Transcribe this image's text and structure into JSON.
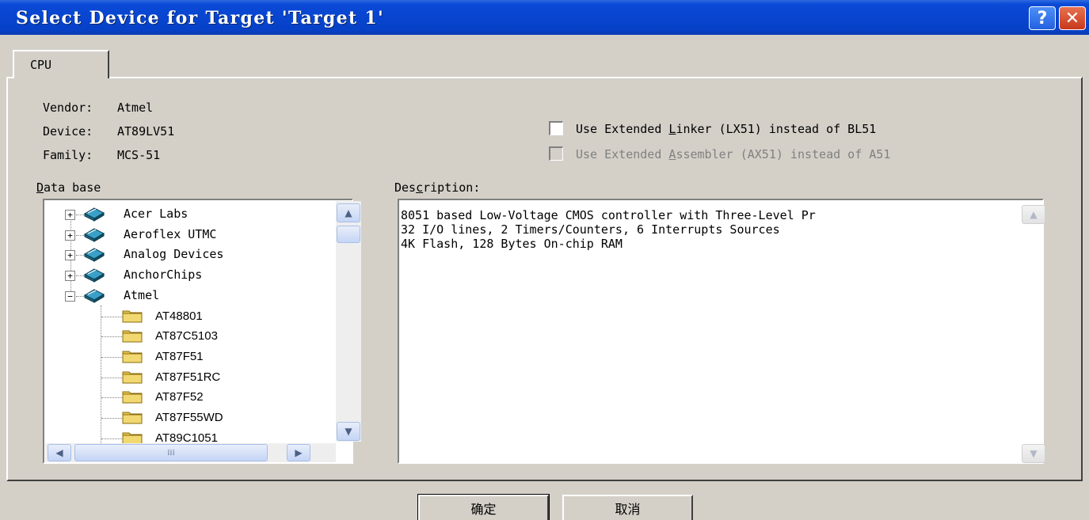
{
  "window": {
    "title": "Select Device for Target 'Target 1'",
    "help_label": "?",
    "close_label": "✕"
  },
  "tabs": [
    {
      "label": "CPU"
    }
  ],
  "device_info": {
    "vendor_label": "Vendor:",
    "vendor_value": "Atmel",
    "device_label": "Device:",
    "device_value": "AT89LV51",
    "family_label": "Family:",
    "family_value": "MCS-51"
  },
  "options": {
    "linker": {
      "pre": "Use Extended ",
      "key": "L",
      "post": "inker (LX51) instead of BL51",
      "checked": false
    },
    "assembler": {
      "pre": "Use Extended ",
      "key": "A",
      "post": "ssembler (AX51) instead of A51",
      "checked": false,
      "enabled": false
    }
  },
  "database": {
    "label_key": "D",
    "label_rest": "ata base",
    "vendors": [
      {
        "name": "Acer Labs",
        "expander": "+"
      },
      {
        "name": "Aeroflex UTMC",
        "expander": "+"
      },
      {
        "name": "Analog Devices",
        "expander": "+"
      },
      {
        "name": "AnchorChips",
        "expander": "+"
      },
      {
        "name": "Atmel",
        "expander": "−"
      }
    ],
    "devices": [
      "AT48801",
      "AT87C5103",
      "AT87F51",
      "AT87F51RC",
      "AT87F52",
      "AT87F55WD",
      "AT89C1051"
    ]
  },
  "description": {
    "label_pre": "Des",
    "label_key": "c",
    "label_post": "ription:",
    "text": "8051 based Low-Voltage CMOS controller with Three-Level Pr\n32 I/O lines, 2 Timers/Counters, 6 Interrupts Sources\n4K Flash, 128 Bytes On-chip RAM"
  },
  "buttons": {
    "ok": "确定",
    "cancel": "取消"
  },
  "icons": {
    "vendor": "book-icon",
    "device": "folder-icon"
  },
  "colors": {
    "titlebar": "#0845cf",
    "face": "#d4d0c8",
    "folder": "#e7c54a"
  }
}
